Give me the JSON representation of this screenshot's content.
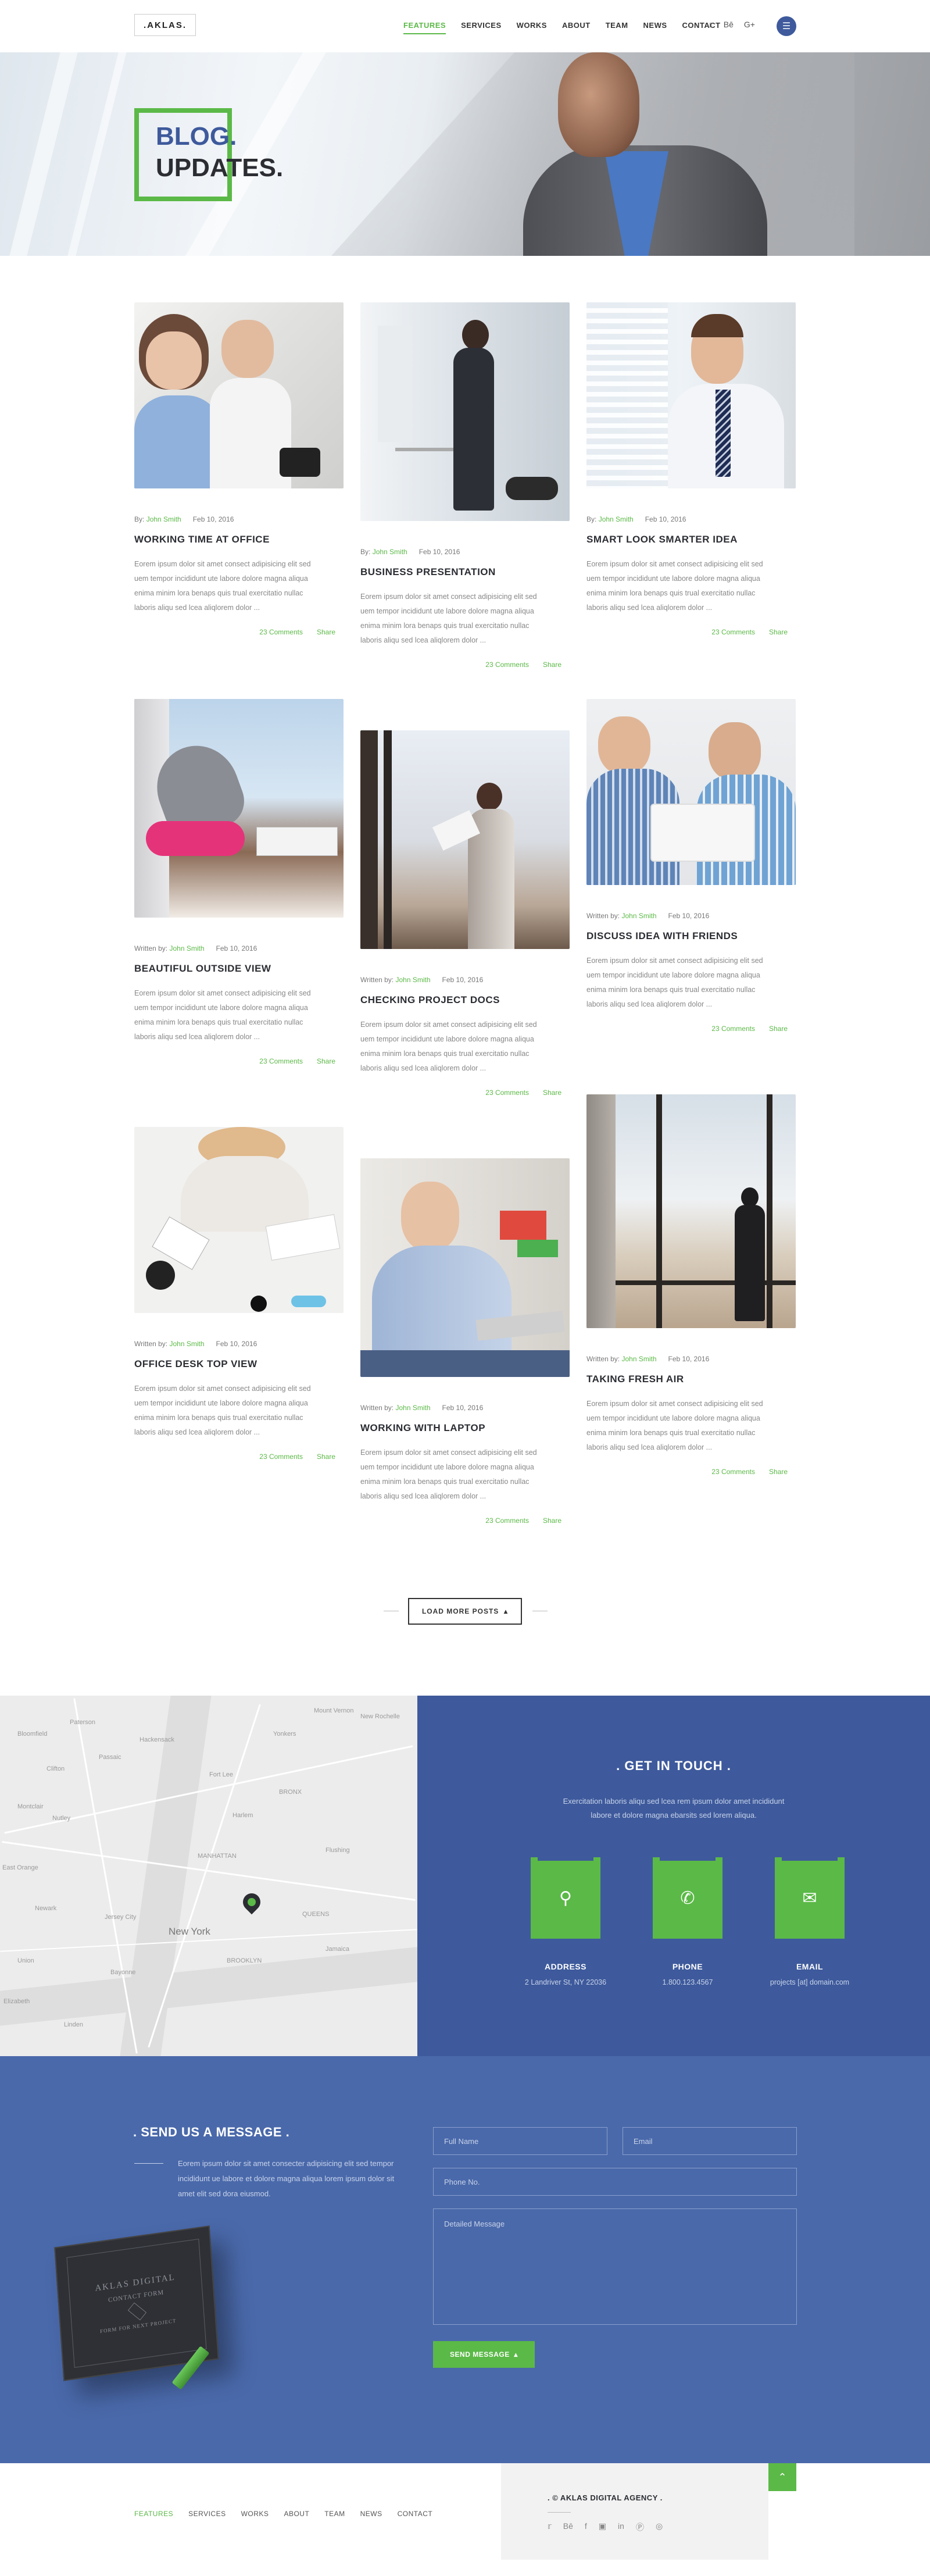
{
  "header": {
    "logo": ".AKLAS.",
    "nav": [
      "FEATURES",
      "SERVICES",
      "WORKS",
      "ABOUT",
      "TEAM",
      "NEWS",
      "CONTACT"
    ],
    "active_nav": "FEATURES",
    "social": [
      "twitter-icon",
      "behance-icon",
      "google-plus-icon"
    ],
    "menu_icon": "menu-icon"
  },
  "hero": {
    "title_line1": "BLOG.",
    "title_line2": "UPDATES."
  },
  "colors": {
    "accent_green": "#5bb947",
    "brand_blue": "#3e5a9c",
    "message_blue": "#4a69aa",
    "heading_dark": "#2b2d33"
  },
  "posts": [
    {
      "prefix": "By:",
      "author": "John Smith",
      "date": "Feb 10, 2016",
      "title": "WORKING TIME AT OFFICE",
      "excerpt": "Eorem ipsum dolor sit amet consect adipisicing elit sed uem tempor incididunt ute labore dolore magna aliqua enima minim lora benaps quis trual exercitatio nullac laboris aliqu sed lcea aliqlorem dolor ...",
      "comments": "23 Comments",
      "share": "Share"
    },
    {
      "prefix": "By:",
      "author": "John Smith",
      "date": "Feb 10, 2016",
      "title": "BUSINESS PRESENTATION",
      "excerpt": "Eorem ipsum dolor sit amet consect adipisicing elit sed uem tempor incididunt ute labore dolore magna aliqua enima minim lora benaps quis trual exercitatio nullac laboris aliqu sed lcea aliqlorem dolor ...",
      "comments": "23 Comments",
      "share": "Share"
    },
    {
      "prefix": "By:",
      "author": "John Smith",
      "date": "Feb 10, 2016",
      "title": "SMART LOOK SMARTER IDEA",
      "excerpt": "Eorem ipsum dolor sit amet consect adipisicing elit sed uem tempor incididunt ute labore dolore magna aliqua enima minim lora benaps quis trual exercitatio nullac laboris aliqu sed lcea aliqlorem dolor ...",
      "comments": "23 Comments",
      "share": "Share"
    },
    {
      "prefix": "Written by:",
      "author": "John Smith",
      "date": "Feb 10, 2016",
      "title": "BEAUTIFUL OUTSIDE VIEW",
      "excerpt": "Eorem ipsum dolor sit amet consect adipisicing elit sed uem tempor incididunt ute labore dolore magna aliqua enima minim lora benaps quis trual exercitatio nullac laboris aliqu sed lcea aliqlorem dolor ...",
      "comments": "23 Comments",
      "share": "Share"
    },
    {
      "prefix": "Written by:",
      "author": "John Smith",
      "date": "Feb 10, 2016",
      "title": "CHECKING PROJECT DOCS",
      "excerpt": "Eorem ipsum dolor sit amet consect adipisicing elit sed uem tempor incididunt ute labore dolore magna aliqua enima minim lora benaps quis trual exercitatio nullac laboris aliqu sed lcea aliqlorem dolor ...",
      "comments": "23 Comments",
      "share": "Share"
    },
    {
      "prefix": "Written by:",
      "author": "John Smith",
      "date": "Feb 10, 2016",
      "title": "DISCUSS IDEA WITH FRIENDS",
      "excerpt": "Eorem ipsum dolor sit amet consect adipisicing elit sed uem tempor incididunt ute labore dolore magna aliqua enima minim lora benaps quis trual exercitatio nullac laboris aliqu sed lcea aliqlorem dolor ...",
      "comments": "23 Comments",
      "share": "Share"
    },
    {
      "prefix": "Written by:",
      "author": "John Smith",
      "date": "Feb 10, 2016",
      "title": "OFFICE DESK TOP VIEW",
      "excerpt": "Eorem ipsum dolor sit amet consect adipisicing elit sed uem tempor incididunt ute labore dolore magna aliqua enima minim lora benaps quis trual exercitatio nullac laboris aliqu sed lcea aliqlorem dolor ...",
      "comments": "23 Comments",
      "share": "Share"
    },
    {
      "prefix": "Written by:",
      "author": "John Smith",
      "date": "Feb 10, 2016",
      "title": "WORKING WITH LAPTOP",
      "excerpt": "Eorem ipsum dolor sit amet consect adipisicing elit sed uem tempor incididunt ute labore dolore magna aliqua enima minim lora benaps quis trual exercitatio nullac laboris aliqu sed lcea aliqlorem dolor ...",
      "comments": "23 Comments",
      "share": "Share"
    },
    {
      "prefix": "Written by:",
      "author": "John Smith",
      "date": "Feb 10, 2016",
      "title": "TAKING FRESH AIR",
      "excerpt": "Eorem ipsum dolor sit amet consect adipisicing elit sed uem tempor incididunt ute labore dolore magna aliqua enima minim lora benaps quis trual exercitatio nullac laboris aliqu sed lcea aliqlorem dolor ...",
      "comments": "23 Comments",
      "share": "Share"
    }
  ],
  "load_more": "LOAD MORE POSTS",
  "map": {
    "city_label": "New York",
    "labels": [
      "Paterson",
      "Clifton",
      "Passaic",
      "Hackensack",
      "Montclair",
      "Bloomfield",
      "Fort Lee",
      "Nutley",
      "East Orange",
      "Newark",
      "Jersey City",
      "Elizabeth",
      "Bayonne",
      "Harlem",
      "MANHATTAN",
      "BROOKLYN",
      "QUEENS",
      "BRONX",
      "Yonkers",
      "Mount Vernon",
      "New Rochelle",
      "Flushing",
      "Jamaica",
      "Union",
      "Linden"
    ]
  },
  "touch": {
    "title": ". GET IN TOUCH .",
    "text": "Exercitation laboris aliqu sed lcea rem ipsum dolor amet incididunt labore et dolore magna ebarsits sed lorem aliqua.",
    "items": [
      {
        "icon": "map-pin-icon",
        "label": "ADDRESS",
        "value": "2 Landriver St, NY 22036"
      },
      {
        "icon": "phone-icon",
        "label": "PHONE",
        "value": "1.800.123.4567"
      },
      {
        "icon": "email-icon",
        "label": "EMAIL",
        "value": "projects [at] domain.com"
      }
    ]
  },
  "message": {
    "title": ". SEND US A MESSAGE .",
    "text": "Eorem ipsum dolor sit amet consecter adipisicing elit sed tempor incididunt ue labore et dolore magna aliqua lorem ipsum dolor sit amet elit sed dora eiusmod.",
    "box_title": "AKLAS DIGITAL",
    "box_subtitle": "CONTACT FORM",
    "box_footer": "FORM FOR NEXT PROJECT",
    "placeholders": {
      "name": "Full Name",
      "email": "Email",
      "phone": "Phone No.",
      "message": "Detailed Message"
    },
    "send": "SEND MESSAGE"
  },
  "footer": {
    "nav": [
      "FEATURES",
      "SERVICES",
      "WORKS",
      "ABOUT",
      "TEAM",
      "NEWS",
      "CONTACT"
    ],
    "active_nav": "FEATURES",
    "brand": ". © AKLAS DIGITAL AGENCY .",
    "social": [
      "twitter-icon",
      "behance-icon",
      "facebook-icon",
      "instagram-icon",
      "linkedin-icon",
      "pinterest-icon",
      "dribbble-icon"
    ]
  }
}
